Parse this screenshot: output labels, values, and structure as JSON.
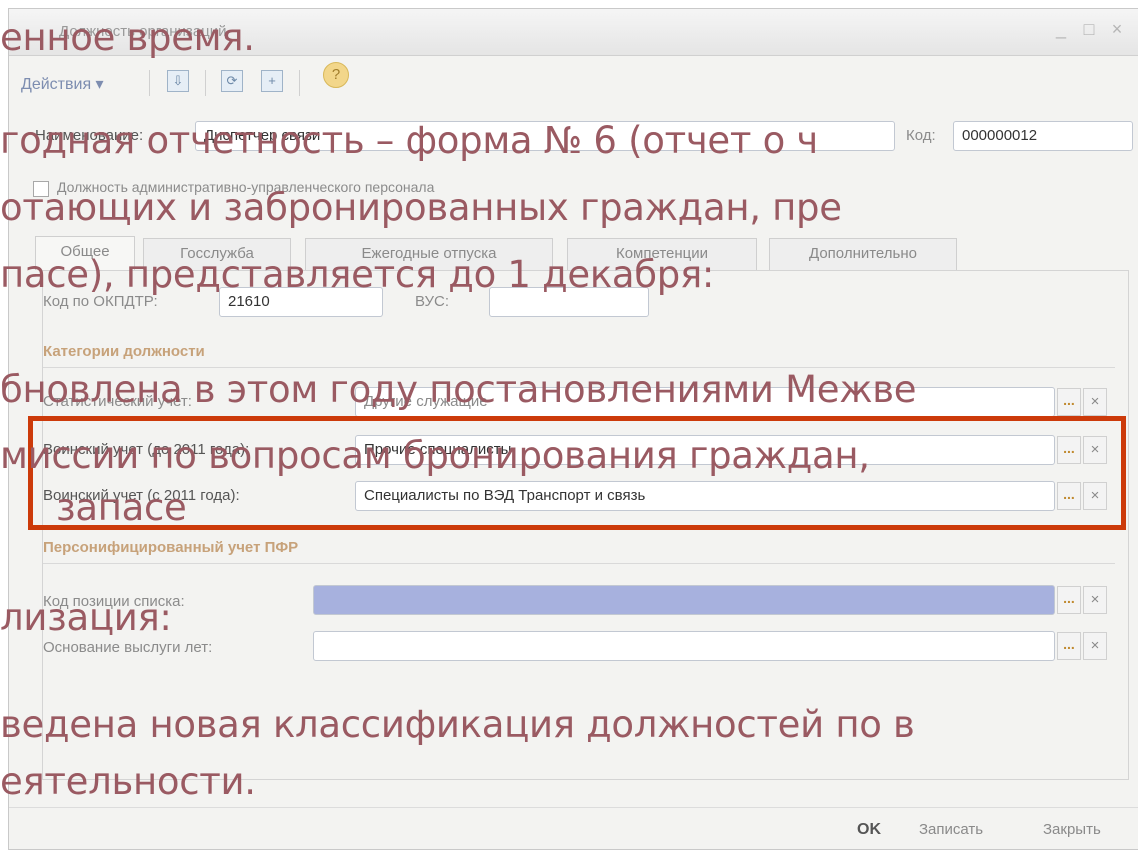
{
  "window": {
    "title": "Должность организаций",
    "controls": [
      "_",
      "□",
      "×"
    ]
  },
  "toolbar": {
    "actions_label": "Действия ▾",
    "icons": [
      "save-icon",
      "refresh-icon",
      "copy-icon"
    ],
    "help_label": "?"
  },
  "form": {
    "name_label": "Наименование:",
    "name_value": "Диспетчер связи",
    "code_label": "Код:",
    "code_value": "000000012",
    "admin_checkbox_label": "Должность административно-управленческого персонала",
    "tabs": [
      "Общее",
      "Госслужба",
      "Ежегодные отпуска",
      "Компетенции",
      "Дополнительно"
    ],
    "okpdtr_label": "Код по ОКПДТР:",
    "okpdtr_value": "21610",
    "vus_label": "ВУС:",
    "vus_value": ""
  },
  "categories": {
    "title": "Категории должности",
    "stat_label": "Статистический учет:",
    "stat_value": "Другие служащие",
    "mil_old_label": "Воинский учет (до 2011 года):",
    "mil_old_value": "Прочие специалисты",
    "mil_new_label": "Воинский учет (с 2011 года):",
    "mil_new_value": "Специалисты по ВЭД Транспорт и связь"
  },
  "pfr": {
    "title": "Персонифицированный учет ПФР",
    "code_label": "Код позиции списка:",
    "code_value": "",
    "basis_label": "Основание выслуги лет:",
    "basis_value": ""
  },
  "footer": {
    "ok": "OK",
    "save": "Записать",
    "close": "Закрыть"
  },
  "field_buttons": {
    "select": "...",
    "clear": "×"
  },
  "overlay_lines": [
    "енное время.",
    "годная отчетность – форма № 6 (отчет о ч",
    "отающих и забронированных граждан, пре",
    "пасе), представляется до 1 декабря:",
    "бновлена в этом году постановлениями Межве",
    "миссии по вопросам бронирования граждан,",
    "запасе",
    "лизация:",
    "ведена новая классификация должностей по в",
    "еятельности."
  ],
  "colors": {
    "overlay_text": "#9a5a62",
    "highlight_box": "#cc3a0a",
    "section_title": "#c7a27a",
    "selected_field": "#a7b1de"
  }
}
